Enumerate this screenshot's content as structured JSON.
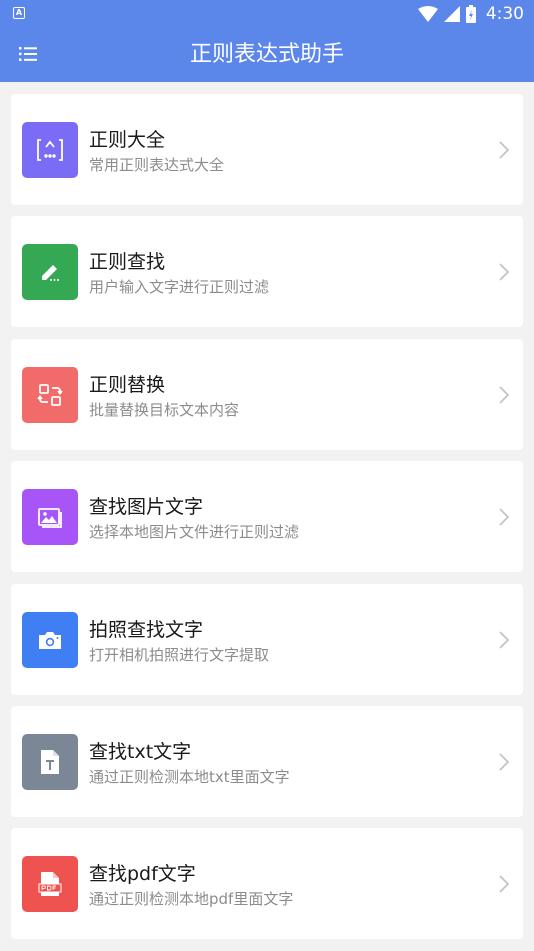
{
  "status_bar": {
    "time": "4:30",
    "app_icon_letter": "A"
  },
  "app_bar": {
    "title": "正则表达式助手",
    "menu_icon": "list-menu-icon"
  },
  "colors": {
    "primary": "#5b86ea",
    "purple": "#7b6cf6",
    "green": "#34a853",
    "red": "#f26b6b",
    "violet": "#a855f7",
    "blue": "#3f7ef3",
    "gray": "#7b8797",
    "pdf_red": "#ef5350"
  },
  "items": [
    {
      "title": "正则大全",
      "subtitle": "常用正则表达式大全",
      "icon": "regex-bracket-icon",
      "color": "#7b6cf6"
    },
    {
      "title": "正则查找",
      "subtitle": "用户输入文字进行正则过滤",
      "icon": "pencil-icon",
      "color": "#34a853"
    },
    {
      "title": "正则替换",
      "subtitle": "批量替换目标文本内容",
      "icon": "swap-icon",
      "color": "#f26b6b"
    },
    {
      "title": "查找图片文字",
      "subtitle": "选择本地图片文件进行正则过滤",
      "icon": "image-icon",
      "color": "#a855f7"
    },
    {
      "title": "拍照查找文字",
      "subtitle": "打开相机拍照进行文字提取",
      "icon": "camera-icon",
      "color": "#3f7ef3"
    },
    {
      "title": "查找txt文字",
      "subtitle": "通过正则检测本地txt里面文字",
      "icon": "txt-file-icon",
      "color": "#7b8797"
    },
    {
      "title": "查找pdf文字",
      "subtitle": "通过正则检测本地pdf里面文字",
      "icon": "pdf-file-icon",
      "color": "#ef5350"
    }
  ]
}
